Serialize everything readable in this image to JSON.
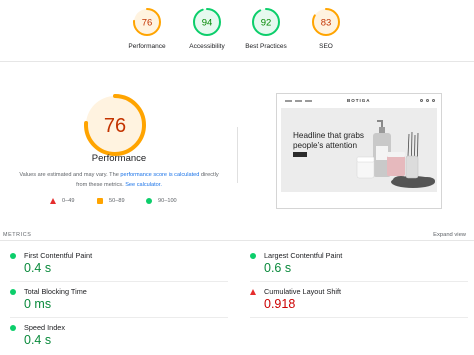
{
  "gauges": [
    {
      "label": "Performance",
      "score": "76",
      "fraction": 0.76,
      "color": "#ffa400",
      "text_color": "#c33300",
      "bg": "#fff3e0"
    },
    {
      "label": "Accessibility",
      "score": "94",
      "fraction": 0.94,
      "color": "#0cce6b",
      "text_color": "#008800",
      "bg": "#e6f9ef"
    },
    {
      "label": "Best Practices",
      "score": "92",
      "fraction": 0.92,
      "color": "#0cce6b",
      "text_color": "#008800",
      "bg": "#e6f9ef"
    },
    {
      "label": "SEO",
      "score": "83",
      "fraction": 0.83,
      "color": "#ffa400",
      "text_color": "#c33300",
      "bg": "#fff3e0"
    }
  ],
  "main": {
    "score": "76",
    "fraction": 0.76,
    "title": "Performance",
    "note_prefix": "Values are estimated and may vary. The ",
    "note_link1": "performance score is calculated",
    "note_mid": " directly from these metrics. ",
    "note_link2": "See calculator."
  },
  "legend": [
    {
      "range": "0–49",
      "shape": "triangle",
      "color": "#e52d2d"
    },
    {
      "range": "50–89",
      "shape": "square",
      "color": "#ffa400"
    },
    {
      "range": "90–100",
      "shape": "circle",
      "color": "#0cce6b"
    }
  ],
  "preview": {
    "logo": "BOTIGA",
    "headline": "Headline that grabs people’s attention"
  },
  "metrics_section": {
    "label": "METRICS",
    "expand": "Expand view"
  },
  "metrics": [
    {
      "name": "First Contentful Paint",
      "value": "0.4 s",
      "status": "good"
    },
    {
      "name": "Largest Contentful Paint",
      "value": "0.6 s",
      "status": "good"
    },
    {
      "name": "Total Blocking Time",
      "value": "0 ms",
      "status": "good"
    },
    {
      "name": "Cumulative Layout Shift",
      "value": "0.918",
      "status": "poor"
    },
    {
      "name": "Speed Index",
      "value": "0.4 s",
      "status": "good"
    }
  ]
}
